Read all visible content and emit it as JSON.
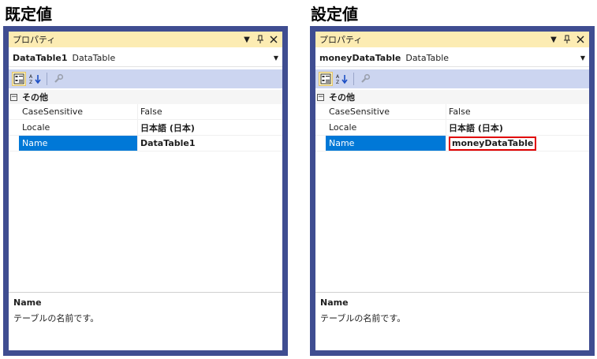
{
  "left": {
    "heading": "既定値",
    "window_title": "プロパティ",
    "object_name": "DataTable1",
    "object_type": "DataTable",
    "category": "その他",
    "properties": [
      {
        "name": "CaseSensitive",
        "value": "False"
      },
      {
        "name": "Locale",
        "value": "日本語 (日本)"
      },
      {
        "name": "Name",
        "value": "DataTable1"
      }
    ],
    "description_name": "Name",
    "description_text": "テーブルの名前です。"
  },
  "right": {
    "heading": "設定値",
    "window_title": "プロパティ",
    "object_name": "moneyDataTable",
    "object_type": "DataTable",
    "category": "その他",
    "properties": [
      {
        "name": "CaseSensitive",
        "value": "False"
      },
      {
        "name": "Locale",
        "value": "日本語 (日本)"
      },
      {
        "name": "Name",
        "value": "moneyDataTable"
      }
    ],
    "description_name": "Name",
    "description_text": "テーブルの名前です。"
  },
  "icons": {
    "dropdown": "dropdown-arrow-icon",
    "pin": "pin-icon",
    "close": "close-icon",
    "categorized": "categorized-icon",
    "alphabetical": "alphabetical-sort-icon",
    "property_pages": "wrench-icon"
  },
  "colors": {
    "frame": "#3f4d91",
    "titlebar": "#fcecb3",
    "toolbar": "#ccd5f0",
    "selection": "#0078d7",
    "highlight_border": "#e00000"
  }
}
